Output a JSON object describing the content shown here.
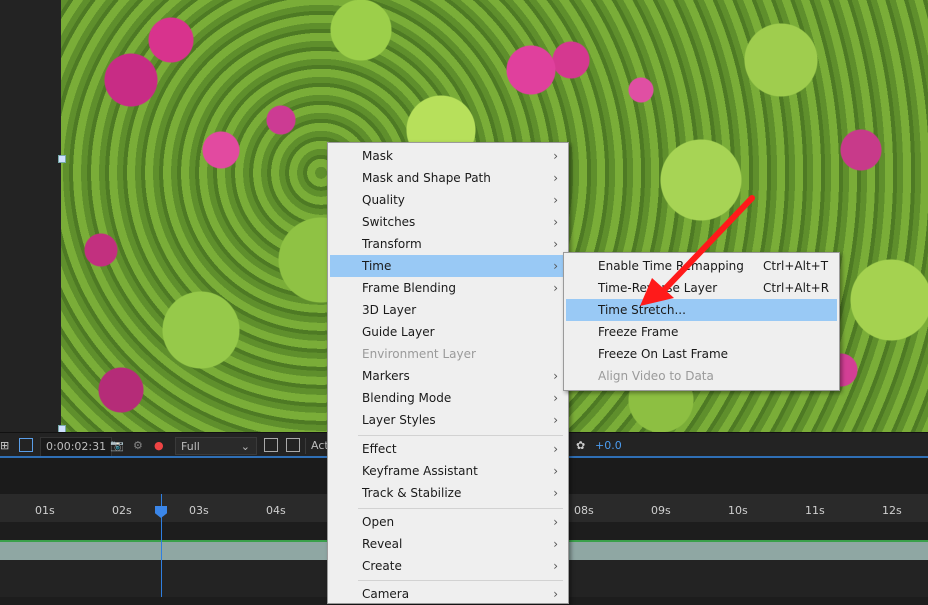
{
  "toolbar": {
    "timecode": "0:00:02:31",
    "resolution": "Full",
    "renderer_partial": "Act",
    "exposure": "+0.0"
  },
  "ruler": {
    "ticks": [
      "01s",
      "02s",
      "03s",
      "04s",
      "08s",
      "09s",
      "10s",
      "11s",
      "12s"
    ]
  },
  "context_menu": {
    "items": [
      {
        "label": "Mask",
        "submenu": true
      },
      {
        "label": "Mask and Shape Path",
        "submenu": true
      },
      {
        "label": "Quality",
        "submenu": true
      },
      {
        "label": "Switches",
        "submenu": true
      },
      {
        "label": "Transform",
        "submenu": true
      },
      {
        "label": "Time",
        "submenu": true,
        "highlighted": true
      },
      {
        "label": "Frame Blending",
        "submenu": true
      },
      {
        "label": "3D Layer",
        "submenu": false
      },
      {
        "label": "Guide Layer",
        "submenu": false
      },
      {
        "label": "Environment Layer",
        "submenu": false,
        "disabled": true
      },
      {
        "label": "Markers",
        "submenu": true
      },
      {
        "label": "Blending Mode",
        "submenu": true
      },
      {
        "label": "Layer Styles",
        "submenu": true
      },
      {
        "label": "Effect",
        "submenu": true
      },
      {
        "label": "Keyframe Assistant",
        "submenu": true
      },
      {
        "label": "Track & Stabilize",
        "submenu": true
      },
      {
        "label": "Open",
        "submenu": true
      },
      {
        "label": "Reveal",
        "submenu": true
      },
      {
        "label": "Create",
        "submenu": true
      },
      {
        "label": "Camera",
        "submenu": true
      }
    ]
  },
  "time_submenu": {
    "items": [
      {
        "label": "Enable Time Remapping",
        "shortcut": "Ctrl+Alt+T"
      },
      {
        "label": "Time-Reverse Layer",
        "shortcut": "Ctrl+Alt+R"
      },
      {
        "label": "Time Stretch...",
        "shortcut": "",
        "highlighted": true
      },
      {
        "label": "Freeze Frame",
        "shortcut": ""
      },
      {
        "label": "Freeze On Last Frame",
        "shortcut": ""
      },
      {
        "label": "Align Video to Data",
        "shortcut": "",
        "disabled": true
      }
    ]
  },
  "icons": {
    "submenu_arrow": "chevron-right-icon",
    "snapshot": "camera-icon",
    "channels": "rgb-channels-icon",
    "exposure": "exposure-icon"
  },
  "colors": {
    "menu_highlight": "#99c9f5",
    "annotation_arrow": "#ff1a1a",
    "playhead": "#3b86e8"
  }
}
